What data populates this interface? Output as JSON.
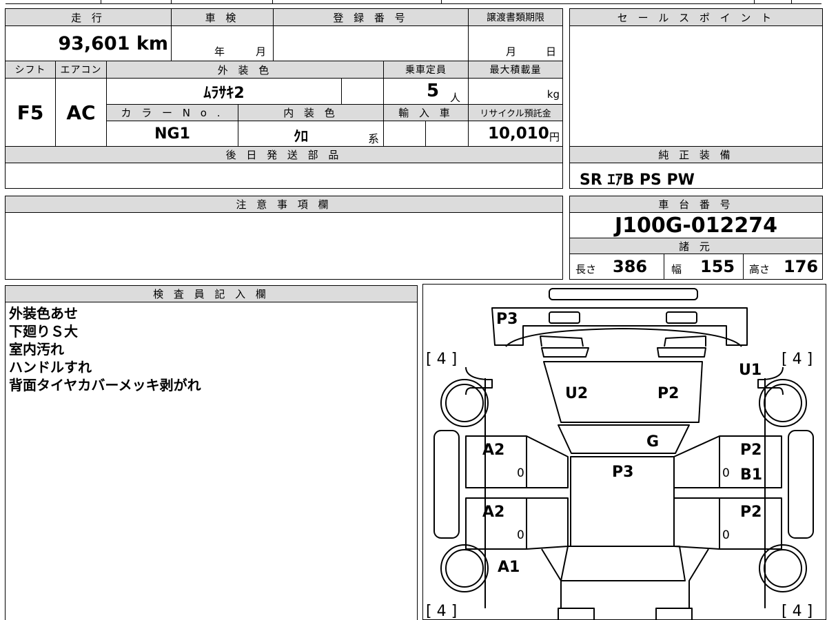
{
  "vehicle": {
    "labels": {
      "mileage": "走 行",
      "inspection": "車 検",
      "registration": "登 録 番 号",
      "transfer_deadline": "譲渡書類期限",
      "shift": "シフト",
      "ac": "エアコン",
      "exterior_color": "外 装 色",
      "capacity": "乗車定員",
      "max_load": "最大積載量",
      "color_no": "カ ラ ー N o .",
      "interior_color": "内 装 色",
      "import": "輸 入 車",
      "recycle_fee": "リサイクル預託金"
    },
    "mileage": "93,601 km",
    "inspection_year_unit": "年",
    "inspection_month_unit": "月",
    "transfer_month_unit": "月",
    "transfer_day_unit": "日",
    "shift": "F5",
    "ac": "AC",
    "exterior_color": "ﾑﾗｻｷ2",
    "capacity": "5",
    "capacity_unit": "人",
    "max_load_unit": "kg",
    "color_no": "NG1",
    "interior_color": "ｸﾛ",
    "interior_suffix": "系",
    "recycle_fee": "10,010",
    "recycle_fee_unit": "円"
  },
  "sections": {
    "sales_point": "セ ー ル ス ポ イ ン ト",
    "later_parts": "後 日 発 送 部 品",
    "genuine_equipment": "純 正 装 備",
    "genuine_equipment_value": "SR ｴｱB PS PW",
    "notes": "注 意 事 項 欄",
    "chassis_number": "車 台 番 号",
    "chassis_number_value": "J100G-012274",
    "specs": "諸 元",
    "inspector": "検 査 員 記 入 欄"
  },
  "specs": {
    "length_label": "長さ",
    "length": "386",
    "width_label": "幅",
    "width": "155",
    "height_label": "高さ",
    "height": "176"
  },
  "inspector_notes": [
    "外装色あせ",
    "下廻りＳ大",
    "室内汚れ",
    "ハンドルすれ",
    "背面タイヤカバーメッキ剥がれ"
  ],
  "diagram": {
    "tire_tl": "[ 4 ]",
    "tire_tr": "[ 4 ]",
    "tire_bl": "[ 4 ]",
    "tire_br": "[ 4 ]",
    "marks": {
      "rear_bumper": "P3",
      "roof_left": "U2",
      "roof_right": "P2",
      "right_rear_fender": "U1",
      "glass": "G",
      "left_rear_door": "A2",
      "left_rear_door_sub": "0",
      "right_rear_door_1": "P2",
      "right_rear_door_2": "B1",
      "right_rear_door_sub": "0",
      "hood_center": "P3",
      "left_front_door": "A2",
      "left_front_door_sub": "0",
      "right_front_door": "P2",
      "right_front_door_sub": "0",
      "left_front_fender": "A1"
    }
  }
}
